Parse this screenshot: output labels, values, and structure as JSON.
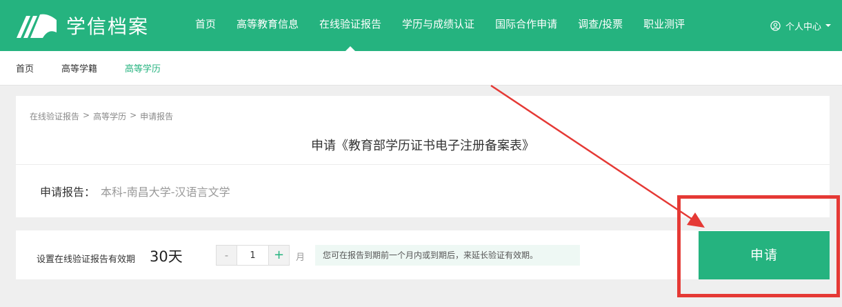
{
  "header": {
    "logo_text": "学信档案",
    "nav": [
      {
        "label": "首页"
      },
      {
        "label": "高等教育信息"
      },
      {
        "label": "在线验证报告"
      },
      {
        "label": "学历与成绩认证"
      },
      {
        "label": "国际合作申请"
      },
      {
        "label": "调查/投票"
      },
      {
        "label": "职业测评"
      }
    ],
    "active_nav_index": 2,
    "user_label": "个人中心"
  },
  "subnav": [
    {
      "label": "首页"
    },
    {
      "label": "高等学籍"
    },
    {
      "label": "高等学历"
    }
  ],
  "breadcrumb": [
    "在线验证报告",
    "高等学历",
    "申请报告"
  ],
  "breadcrumb_sep": ">",
  "card_title": "申请《教育部学历证书电子注册备案表》",
  "report": {
    "label": "申请报告：",
    "value": "本科-南昌大学-汉语言文学"
  },
  "validity": {
    "label": "设置在线验证报告有效期",
    "days": "30天",
    "minus": "-",
    "plus": "+",
    "months_value": "1",
    "unit": "月",
    "tip": "您可在报告到期前一个月内或到期后，来延长验证有效期。"
  },
  "apply_button": "申请",
  "colors": {
    "brand_green": "#25b37f",
    "annotation_red": "#e53935"
  },
  "icons": [
    "logo-book-icon",
    "user-circle-icon",
    "caret-down-icon",
    "annotation-arrow-icon"
  ]
}
